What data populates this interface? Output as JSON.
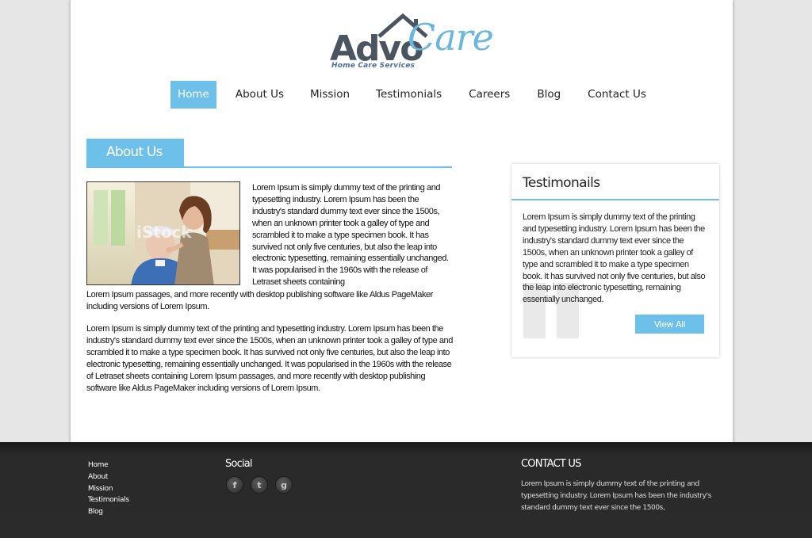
{
  "logo": {
    "word1": "Advo",
    "word2": "Care",
    "tagline": "Home Care Services"
  },
  "nav": {
    "items": [
      {
        "label": "Home"
      },
      {
        "label": "About Us"
      },
      {
        "label": "Mission"
      },
      {
        "label": "Testimonials"
      },
      {
        "label": "Careers"
      },
      {
        "label": "Blog"
      },
      {
        "label": "Contact Us"
      }
    ],
    "active": "Home"
  },
  "about": {
    "title": "About Us",
    "paragraph1_wrap": "Lorem Ipsum is simply dummy text of the printing and typesetting industry. Lorem Ipsum has been the industry's standard dummy text ever since the 1500s, when an unknown printer took a galley of type and scrambled it to make a type specimen book. It has survived not only five centuries, but also the leap into electronic typesetting, remaining essentially unchanged. It was popularised in the 1960s with the release of Letraset sheets containing",
    "paragraph1_rest": "Lorem Ipsum passages, and more recently with desktop publishing software like Aldus PageMaker including versions of Lorem Ipsum.",
    "paragraph2": "Lorem Ipsum is simply dummy text of the printing and typesetting industry. Lorem Ipsum has been the industry's standard dummy text ever since the 1500s, when an unknown printer took a galley of type and scrambled it to make a type specimen book. It has survived not only five centuries, but also the leap into electronic typesetting, remaining essentially unchanged. It was popularised in the 1960s with the release of Letraset sheets containing Lorem Ipsum passages, and more recently with desktop publishing software like Aldus PageMaker including versions of Lorem Ipsum.",
    "photo_watermark": "iStock"
  },
  "testimonials": {
    "title": "Testimonails",
    "text": "Lorem Ipsum is simply dummy text of the printing and typesetting industry. Lorem Ipsum has been the industry's standard dummy text ever since the 1500s, when an unknown printer took a galley of type and scrambled it to make a type specimen book. It has survived not only five centuries, but also the leap into electronic typesetting, remaining essentially unchanged.",
    "button": "View All"
  },
  "footer": {
    "links": [
      {
        "label": "Home"
      },
      {
        "label": "About"
      },
      {
        "label": "Mission"
      },
      {
        "label": "Testimonials"
      },
      {
        "label": "Blog"
      }
    ],
    "social_title": "Social",
    "social_icons": [
      {
        "name": "facebook-icon",
        "glyph": "f"
      },
      {
        "name": "twitter-icon",
        "glyph": "t"
      },
      {
        "name": "google-icon",
        "glyph": "g"
      }
    ],
    "contact_title": "CONTACT US",
    "contact_text": "Lorem Ipsum is simply dummy text of the printing and typesetting industry. Lorem Ipsum has been the industry's standard dummy text ever since the 1500s,"
  },
  "colors": {
    "accent": "#6cc0ea",
    "logo_gray": "#4a5560",
    "footer_bg": "#2b2b2b",
    "page_bg": "#e6e6e6"
  }
}
